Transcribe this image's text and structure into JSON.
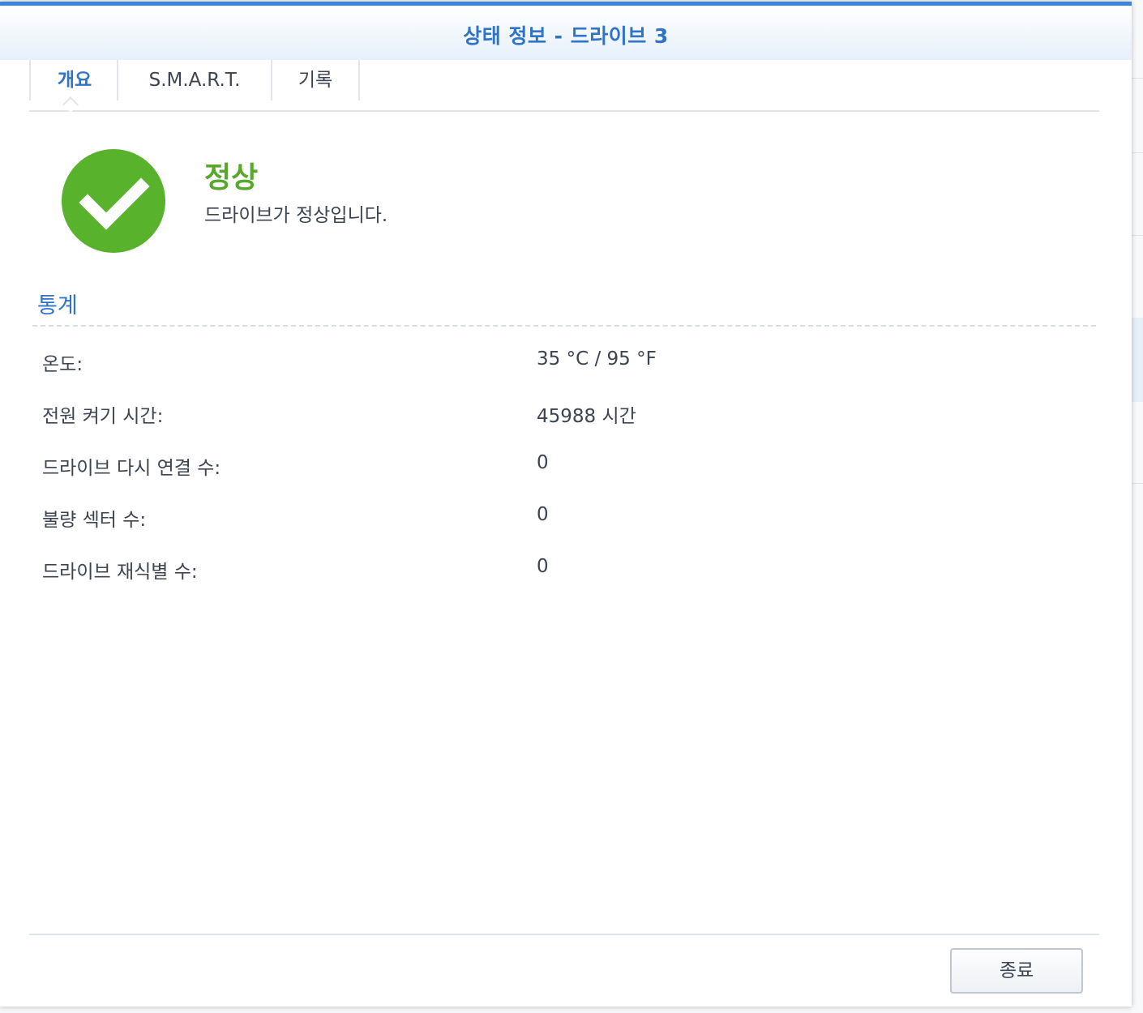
{
  "dialog": {
    "title": "상태 정보 - 드라이브 3"
  },
  "tabs": [
    {
      "label": "개요",
      "active": true
    },
    {
      "label": "S.M.A.R.T.",
      "active": false
    },
    {
      "label": "기록",
      "active": false
    }
  ],
  "status": {
    "icon": "check-circle-icon",
    "title": "정상",
    "description": "드라이브가 정상입니다.",
    "color": "#58a82b"
  },
  "statistics": {
    "title": "통계",
    "rows": [
      {
        "label": "온도:",
        "value": "35 °C / 95 °F"
      },
      {
        "label": "전원 켜기 시간:",
        "value": "45988 시간"
      },
      {
        "label": "드라이브 다시 연결 수:",
        "value": "0"
      },
      {
        "label": "불량 섹터 수:",
        "value": "0"
      },
      {
        "label": "드라이브 재식별 수:",
        "value": "0"
      }
    ]
  },
  "footer": {
    "close_label": "종료"
  },
  "colors": {
    "accent": "#2e74c9",
    "title_bar_border": "#3a86dc",
    "ok_green": "#58a82b",
    "text": "#3b4450"
  }
}
